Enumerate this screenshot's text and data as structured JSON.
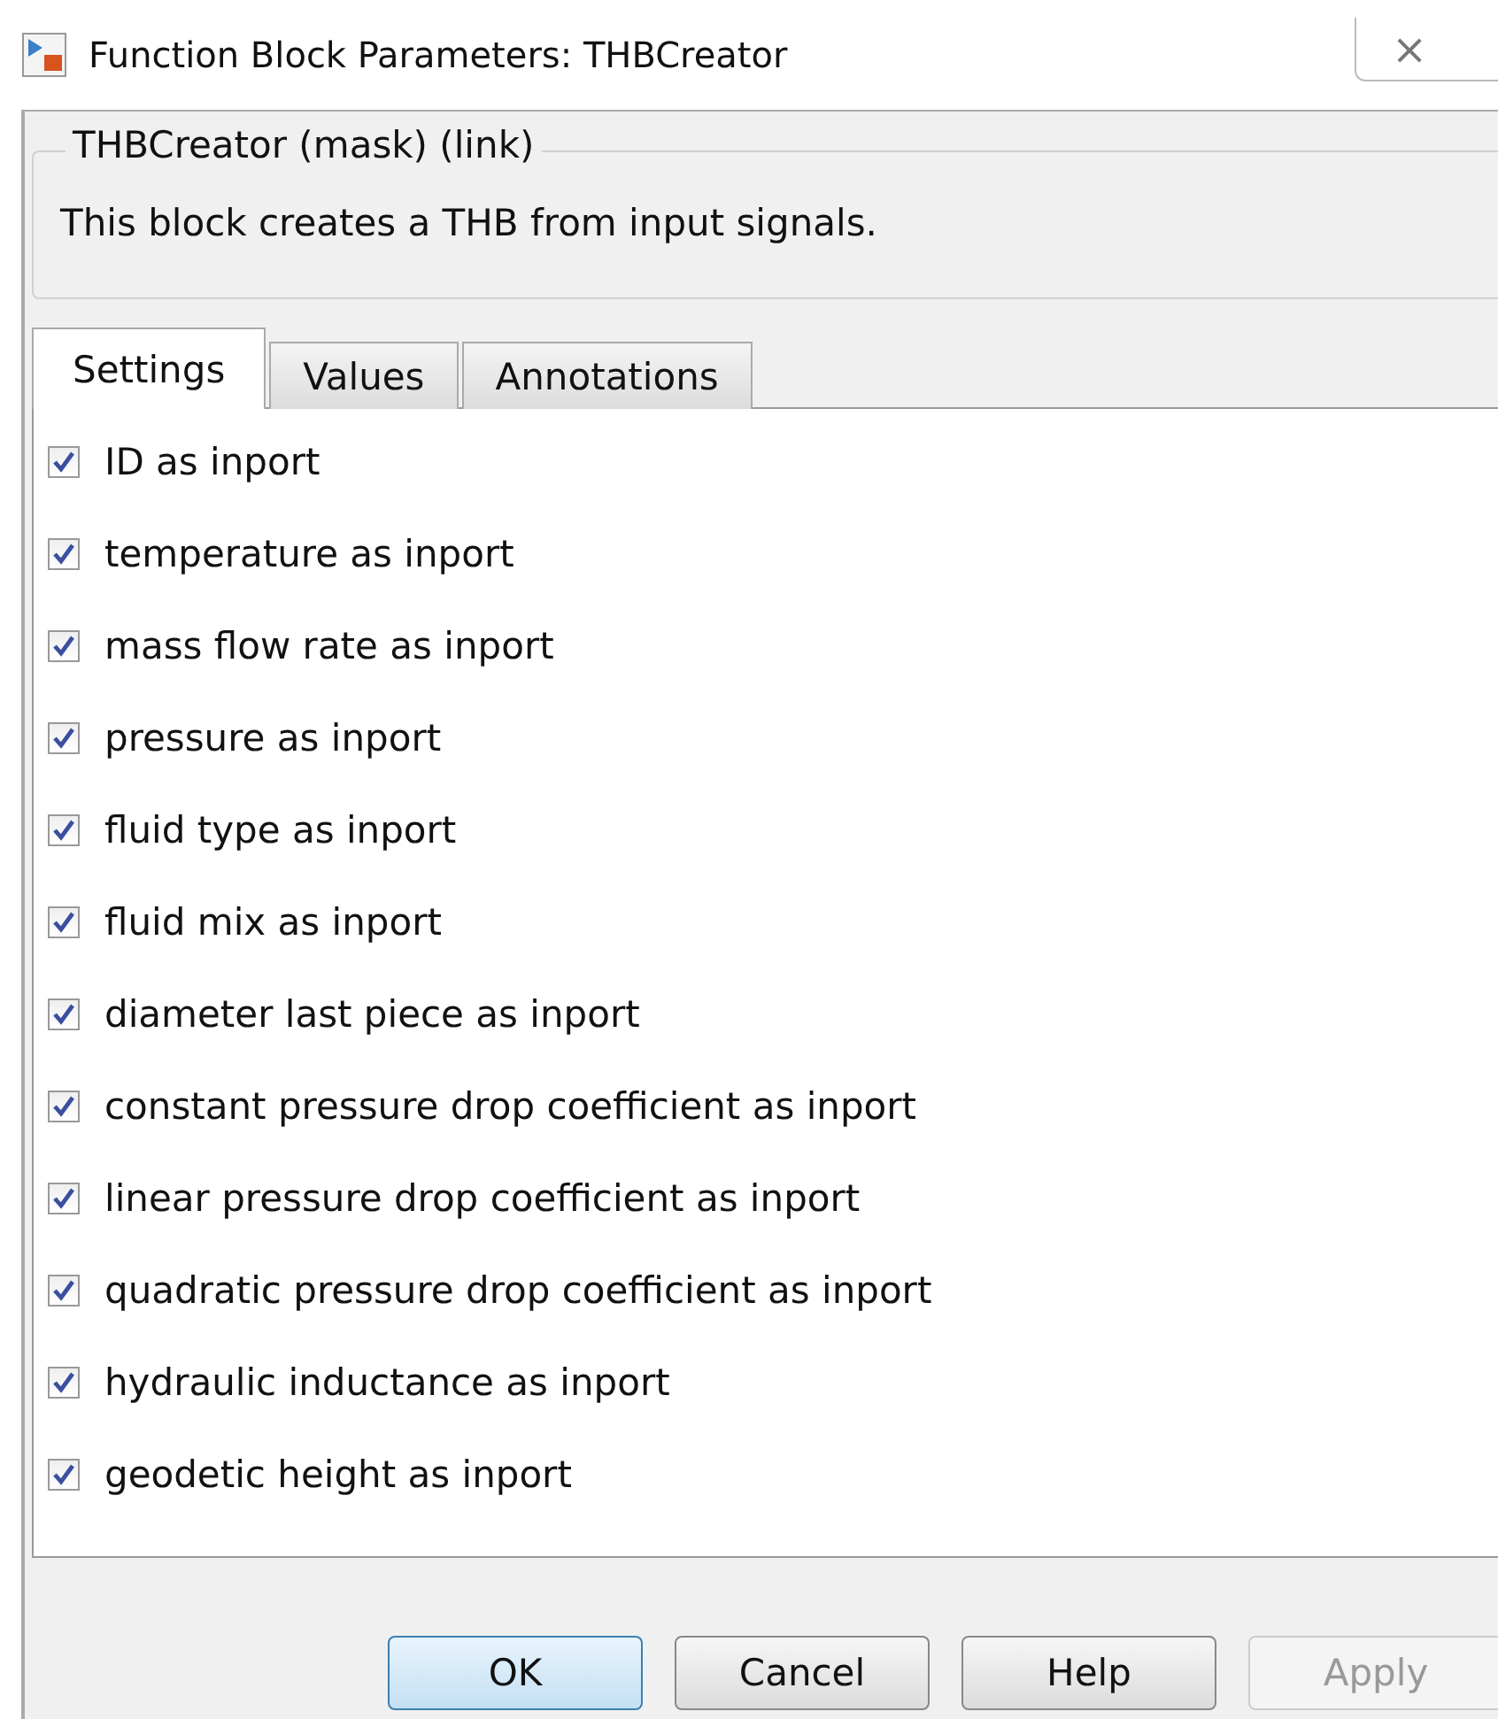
{
  "window": {
    "title": "Function Block Parameters: THBCreator",
    "close": "⨯"
  },
  "group": {
    "title": "THBCreator (mask) (link)",
    "description": "This block creates a THB from input signals."
  },
  "tabs": [
    {
      "label": "Settings",
      "selected": true
    },
    {
      "label": "Values",
      "selected": false
    },
    {
      "label": "Annotations",
      "selected": false
    }
  ],
  "options": [
    {
      "label": "ID as inport",
      "checked": true
    },
    {
      "label": "temperature as inport",
      "checked": true
    },
    {
      "label": "mass flow rate as inport",
      "checked": true
    },
    {
      "label": "pressure as inport",
      "checked": true
    },
    {
      "label": "fluid type as inport",
      "checked": true
    },
    {
      "label": "fluid mix as inport",
      "checked": true
    },
    {
      "label": "diameter last piece as inport",
      "checked": true
    },
    {
      "label": "constant pressure drop coefficient as inport",
      "checked": true
    },
    {
      "label": "linear pressure drop coefficient as inport",
      "checked": true
    },
    {
      "label": "quadratic pressure drop coefficient as inport",
      "checked": true
    },
    {
      "label": "hydraulic inductance as inport",
      "checked": true
    },
    {
      "label": "geodetic height as inport",
      "checked": true
    }
  ],
  "buttons": [
    {
      "label": "OK",
      "default": true,
      "disabled": false
    },
    {
      "label": "Cancel",
      "default": false,
      "disabled": false
    },
    {
      "label": "Help",
      "default": false,
      "disabled": false
    },
    {
      "label": "Apply",
      "default": false,
      "disabled": true
    }
  ]
}
